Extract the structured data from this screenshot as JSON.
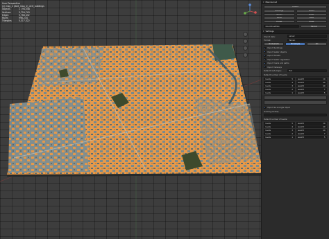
{
  "viewport": {
    "mode": "User Perspective",
    "object": "(1) map_2 (dart_map_1)_vert_buildings",
    "stats": [
      {
        "label": "Objects",
        "value": "1 / 94,548"
      },
      {
        "label": "Vertices",
        "value": "3,726,743"
      },
      {
        "label": "Edges",
        "value": "5,768,432"
      },
      {
        "label": "Faces",
        "value": "998,234"
      },
      {
        "label": "Triangles",
        "value": "5,317,322"
      }
    ]
  },
  "colors": {
    "buildings": "#e6994a",
    "ground": "#7a8a8c",
    "vegetation": "#3e4a2c",
    "panel": "#2b2b2b",
    "accent": "#4772b3"
  },
  "panel": {
    "header": "Blendernet",
    "top_button": "Extent",
    "button_grid": [
      "Buildings",
      "Roads",
      "Terrain",
      "Water",
      "Parks",
      "Rails",
      "Forest",
      "Coast"
    ],
    "source_field": "OpenStreetMap",
    "source_button": "Cancel",
    "settings_header": "Settings",
    "import_data_label": "Import data:",
    "import_data_value": "server",
    "format_label": "Format:",
    "format_value": "Terrain",
    "mode_tabs": [
      "3D Realistic",
      "3D Simple",
      "2D"
    ],
    "checkboxes": [
      "Import buildings",
      "Import water objects",
      "Import forests",
      "Import water vegetation",
      "Import roads and paths",
      "Import railways"
    ],
    "roof_label": "Default roof shape:",
    "roof_value": "flat",
    "levels_label": "Default number of levels:",
    "level_rows": [
      {
        "a": "levels",
        "av": "5",
        "b": "weight",
        "bv": "10"
      },
      {
        "a": "levels",
        "av": "4",
        "b": "weight",
        "bv": "40"
      },
      {
        "a": "levels",
        "av": "3",
        "b": "weight",
        "bv": "40"
      },
      {
        "a": "levels",
        "av": "2",
        "b": "weight",
        "bv": "7"
      },
      {
        "a": "levels",
        "av": "1",
        "b": "weight",
        "bv": "5"
      }
    ],
    "import_single": "Import as a single object",
    "overlay_label": "Overlay (below):",
    "overlay_value": "",
    "levels2_label": "Default number of levels:",
    "level_rows2": [
      {
        "a": "levels",
        "av": "5",
        "b": "weight",
        "bv": "10"
      },
      {
        "a": "levels",
        "av": "4",
        "b": "weight",
        "bv": "40"
      },
      {
        "a": "levels",
        "av": "3",
        "b": "weight",
        "bv": "40"
      },
      {
        "a": "levels",
        "av": "2",
        "b": "weight",
        "bv": "7"
      },
      {
        "a": "levels",
        "av": "1",
        "b": "weight",
        "bv": "5"
      }
    ]
  }
}
